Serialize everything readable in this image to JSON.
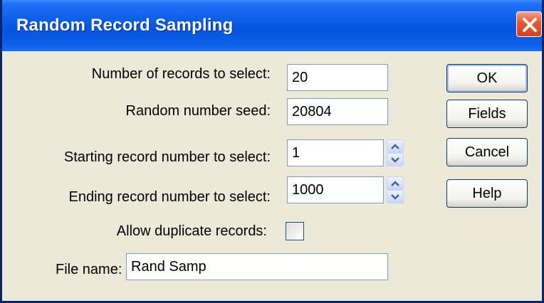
{
  "window": {
    "title": "Random Record Sampling"
  },
  "form": {
    "num_records": {
      "label": "Number of records to select:",
      "value": "20"
    },
    "seed": {
      "label": "Random number seed:",
      "value": "20804"
    },
    "start_record": {
      "label": "Starting record number to select:",
      "value": "1"
    },
    "end_record": {
      "label": "Ending record number to select:",
      "value": "1000"
    },
    "allow_duplicates": {
      "label": "Allow duplicate records:",
      "checked": false
    },
    "file_name": {
      "label": "File name:",
      "value": "Rand Samp"
    }
  },
  "buttons": {
    "ok": "OK",
    "fields": "Fields",
    "cancel": "Cancel",
    "help": "Help"
  },
  "icons": {
    "close": "close-icon",
    "spin_up": "up-arrow-icon",
    "spin_down": "down-arrow-icon"
  },
  "colors": {
    "titlebar": "#0A5BE6",
    "close": "#E85B33",
    "dialog_bg": "#ECE9D8",
    "field_border": "#7F9DB9",
    "button_border": "#003C74"
  }
}
